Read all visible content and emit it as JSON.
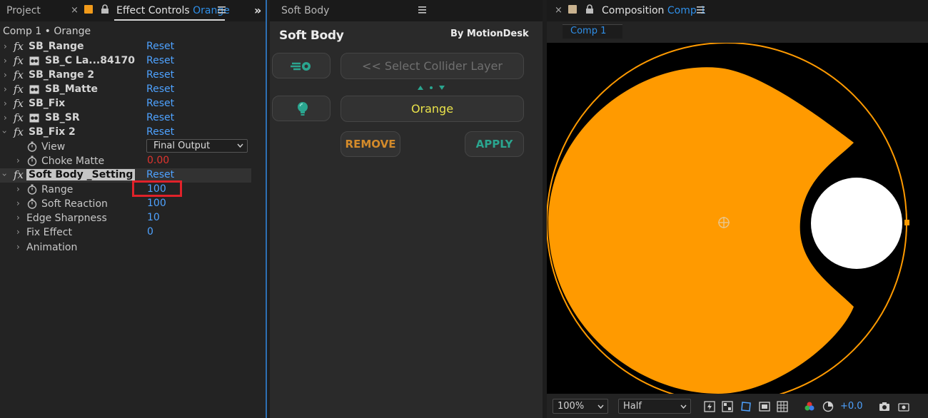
{
  "left_panel": {
    "tabs": {
      "project": "Project",
      "effect_controls_prefix": "Effect Controls",
      "effect_controls_layer": "Orange"
    },
    "breadcrumb": "Comp 1 • Orange",
    "effects": [
      {
        "name": "SB_Range",
        "reset": "Reset"
      },
      {
        "name": "SB_C La...84170",
        "reset": "Reset"
      },
      {
        "name": "SB_Range 2",
        "reset": "Reset"
      },
      {
        "name": "SB_Matte",
        "reset": "Reset"
      },
      {
        "name": "SB_Fix",
        "reset": "Reset"
      },
      {
        "name": "SB_SR",
        "reset": "Reset"
      },
      {
        "name": "SB_Fix 2",
        "reset": "Reset"
      },
      {
        "name": "Soft Body _Setting",
        "reset": "Reset"
      }
    ],
    "sb_fix2_props": {
      "view_label": "View",
      "view_value": "Final Output",
      "choke_label": "Choke Matte",
      "choke_value": "0.00"
    },
    "setting_props": {
      "range_label": "Range",
      "range_value": "100",
      "soft_reaction_label": "Soft Reaction",
      "soft_reaction_value": "100",
      "edge_sharpness_label": "Edge Sharpness",
      "edge_sharpness_value": "10",
      "fix_effect_label": "Fix Effect",
      "fix_effect_value": "0",
      "animation_label": "Animation"
    }
  },
  "mid_panel": {
    "tab": "Soft Body",
    "title": "Soft Body",
    "brand": "By MotionDesk",
    "collider_button": "<< Select Collider Layer",
    "layer_button": "Orange",
    "remove_button": "REMOVE",
    "apply_button": "APPLY"
  },
  "right_panel": {
    "tab_prefix": "Composition",
    "tab_comp": "Comp 1",
    "subtab": "Comp 1",
    "zoom": "100%",
    "resolution": "Half",
    "exposure": "+0.0"
  },
  "colors": {
    "orange_layer": "#ff9a00",
    "accent_blue": "#2f8fe8",
    "teal": "#2aa58f",
    "remove_text": "#d38a2a",
    "highlight_red": "#e0222a"
  }
}
